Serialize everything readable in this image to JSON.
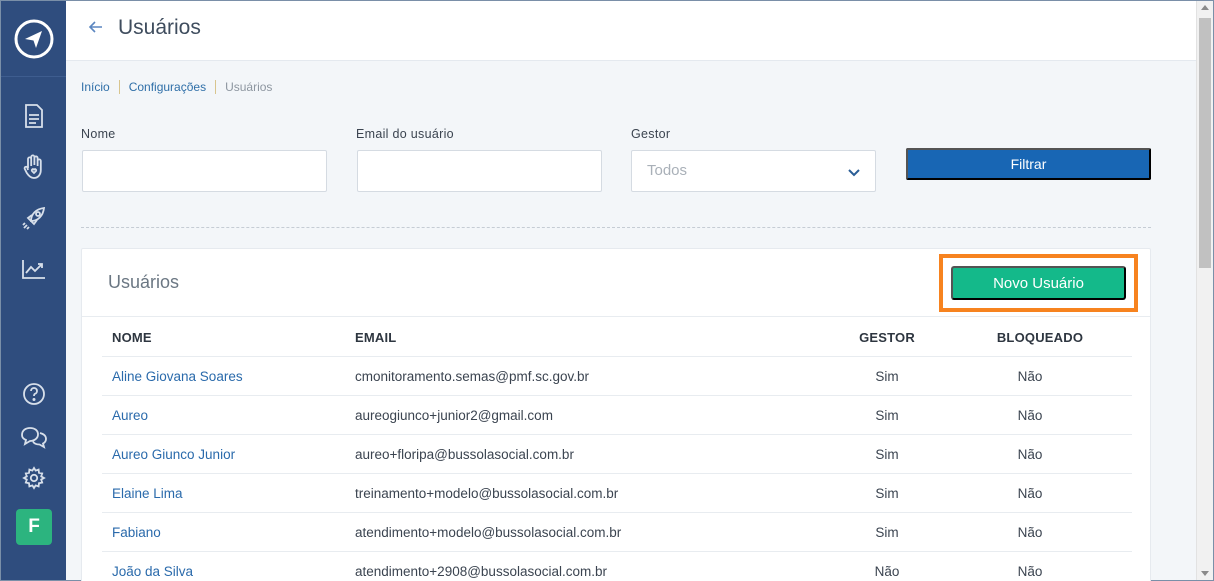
{
  "header": {
    "title": "Usuários"
  },
  "breadcrumb": [
    "Início",
    "Configurações",
    "Usuários"
  ],
  "filters": {
    "name_label": "Nome",
    "email_label": "Email do usuário",
    "gestor_label": "Gestor",
    "gestor_value": "Todos",
    "filter_button": "Filtrar"
  },
  "card": {
    "title": "Usuários",
    "new_button": "Novo Usuário",
    "columns": [
      "NOME",
      "EMAIL",
      "GESTOR",
      "BLOQUEADO"
    ],
    "rows": [
      {
        "name": "Aline Giovana Soares",
        "email": "cmonitoramento.semas@pmf.sc.gov.br",
        "gestor": "Sim",
        "bloqueado": "Não"
      },
      {
        "name": "Aureo",
        "email": "aureogiunco+junior2@gmail.com",
        "gestor": "Sim",
        "bloqueado": "Não"
      },
      {
        "name": "Aureo Giunco Junior",
        "email": "aureo+floripa@bussolasocial.com.br",
        "gestor": "Sim",
        "bloqueado": "Não"
      },
      {
        "name": "Elaine Lima",
        "email": "treinamento+modelo@bussolasocial.com.br",
        "gestor": "Sim",
        "bloqueado": "Não"
      },
      {
        "name": "Fabiano",
        "email": "atendimento+modelo@bussolasocial.com.br",
        "gestor": "Sim",
        "bloqueado": "Não"
      },
      {
        "name": "João da Silva",
        "email": "atendimento+2908@bussolasocial.com.br",
        "gestor": "Não",
        "bloqueado": "Não"
      }
    ]
  },
  "sidebar": {
    "icons": [
      "logo-compass-icon",
      "document-icon",
      "hand-heart-icon",
      "rocket-icon",
      "chart-trend-icon",
      "help-icon",
      "chat-icon",
      "gear-icon"
    ],
    "avatar": "F"
  },
  "colors": {
    "sidebar": "#2f4d7e",
    "primary": "#1866b4",
    "success": "#14b98a",
    "highlight": "#f7831f",
    "link": "#2a6aab"
  }
}
